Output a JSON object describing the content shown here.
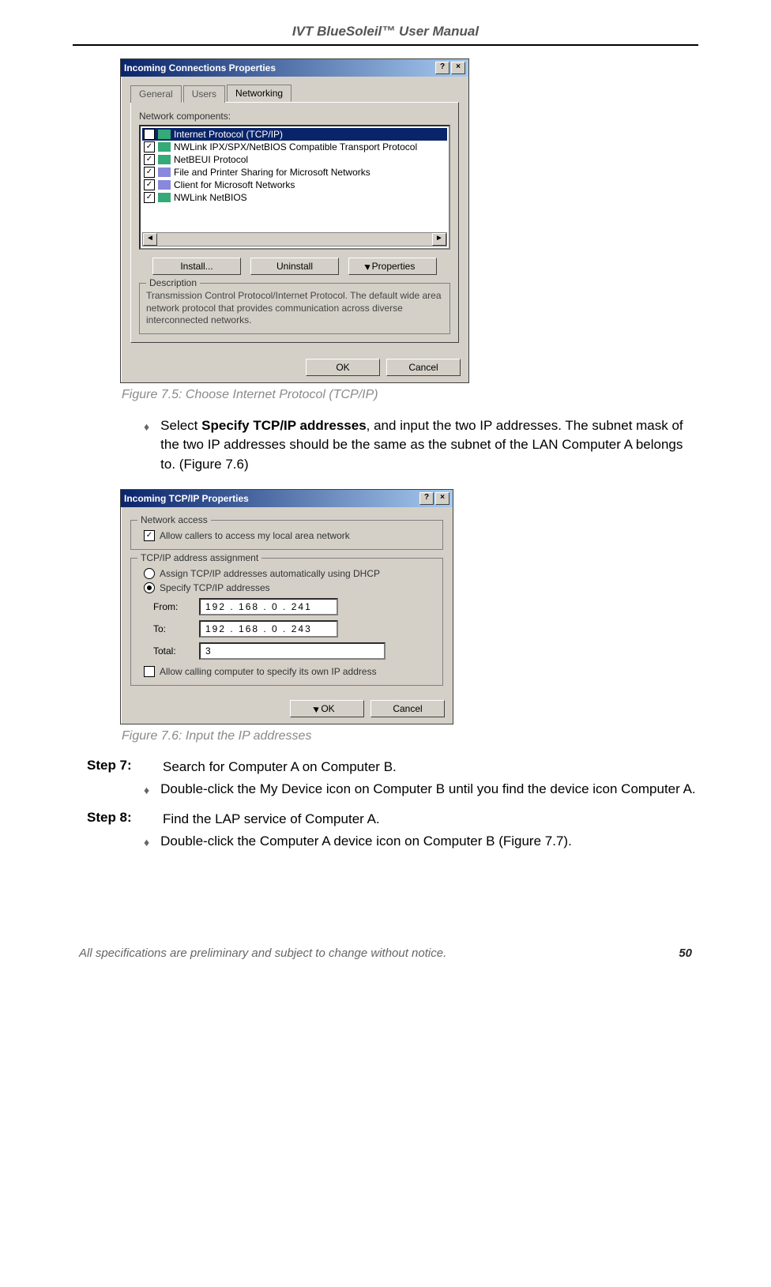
{
  "doc": {
    "title": "IVT BlueSoleil™ User Manual",
    "footer": "All specifications are preliminary and subject to change without notice.",
    "page": "50"
  },
  "fig1": {
    "window_title": "Incoming Connections Properties",
    "help_btn": "?",
    "close_btn": "×",
    "tabs": {
      "general": "General",
      "users": "Users",
      "networking": "Networking"
    },
    "components_label": "Network components:",
    "items": {
      "tcpip": "Internet Protocol (TCP/IP)",
      "nwlink": "NWLink IPX/SPX/NetBIOS Compatible Transport Protocol",
      "netbeui": "NetBEUI Protocol",
      "fileprint": "File and Printer Sharing for Microsoft Networks",
      "client": "Client for Microsoft Networks",
      "nwlinknb": "NWLink NetBIOS"
    },
    "check": "✓",
    "scroll_left": "◄",
    "scroll_right": "►",
    "install": "Install...",
    "uninstall": "Uninstall",
    "properties": "Properties",
    "desc_label": "Description",
    "desc": "Transmission Control Protocol/Internet Protocol. The default wide area network protocol that provides communication across diverse interconnected networks.",
    "ok": "OK",
    "cancel": "Cancel",
    "caption": "Figure 7.5: Choose Internet Protocol (TCP/IP)"
  },
  "bullet1": {
    "pre": "Select ",
    "bold": "Specify TCP/IP addresses",
    "post": ", and input the two IP addresses. The subnet mask of the two IP addresses should be the same as the subnet of the LAN Computer A belongs to. (Figure 7.6)"
  },
  "fig2": {
    "window_title": "Incoming TCP/IP Properties",
    "help_btn": "?",
    "close_btn": "×",
    "group1": "Network access",
    "allow_lan": "Allow callers to access my local area network",
    "group2": "TCP/IP address assignment",
    "radio_dhcp": "Assign TCP/IP addresses automatically using DHCP",
    "radio_spec": "Specify TCP/IP addresses",
    "from_label": "From:",
    "from_ip": "192 . 168 .   0  . 241",
    "to_label": "To:",
    "to_ip": "192 . 168 .   0  . 243",
    "total_label": "Total:",
    "total_val": "3",
    "allow_own": "Allow calling computer to specify its own IP address",
    "ok": "OK",
    "cancel": "Cancel",
    "caption": "Figure 7.6: Input the IP addresses",
    "check": "✓"
  },
  "step7": {
    "label": "Step 7:",
    "text": "Search for Computer A on Computer B.",
    "bullet": "Double-click the My Device icon on Computer B until you find the device icon Computer A."
  },
  "step8": {
    "label": "Step 8:",
    "text": "Find the LAP service of Computer A.",
    "bullet": "Double-click the Computer A device icon on Computer B (Figure 7.7)."
  }
}
